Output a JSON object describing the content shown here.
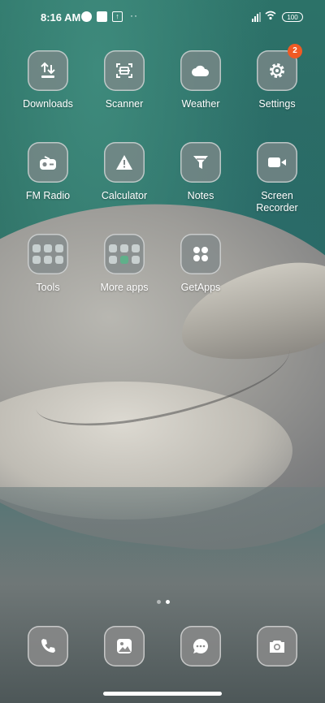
{
  "statusbar": {
    "time": "8:16 AM",
    "battery": "100"
  },
  "apps": [
    {
      "label": "Downloads",
      "icon": "downloads-icon"
    },
    {
      "label": "Scanner",
      "icon": "scanner-icon"
    },
    {
      "label": "Weather",
      "icon": "weather-icon"
    },
    {
      "label": "Settings",
      "icon": "settings-icon",
      "badge": "2"
    },
    {
      "label": "FM Radio",
      "icon": "radio-icon"
    },
    {
      "label": "Calculator",
      "icon": "calculator-icon"
    },
    {
      "label": "Notes",
      "icon": "notes-icon"
    },
    {
      "label": "Screen Recorder",
      "icon": "screen-recorder-icon"
    },
    {
      "label": "Tools",
      "icon": "folder-icon"
    },
    {
      "label": "More apps",
      "icon": "folder-icon"
    },
    {
      "label": "GetApps",
      "icon": "getapps-icon"
    }
  ],
  "dock": [
    {
      "icon": "phone-icon"
    },
    {
      "icon": "gallery-icon"
    },
    {
      "icon": "messages-icon"
    },
    {
      "icon": "camera-icon"
    }
  ],
  "colors": {
    "badge": "#f05a24"
  }
}
